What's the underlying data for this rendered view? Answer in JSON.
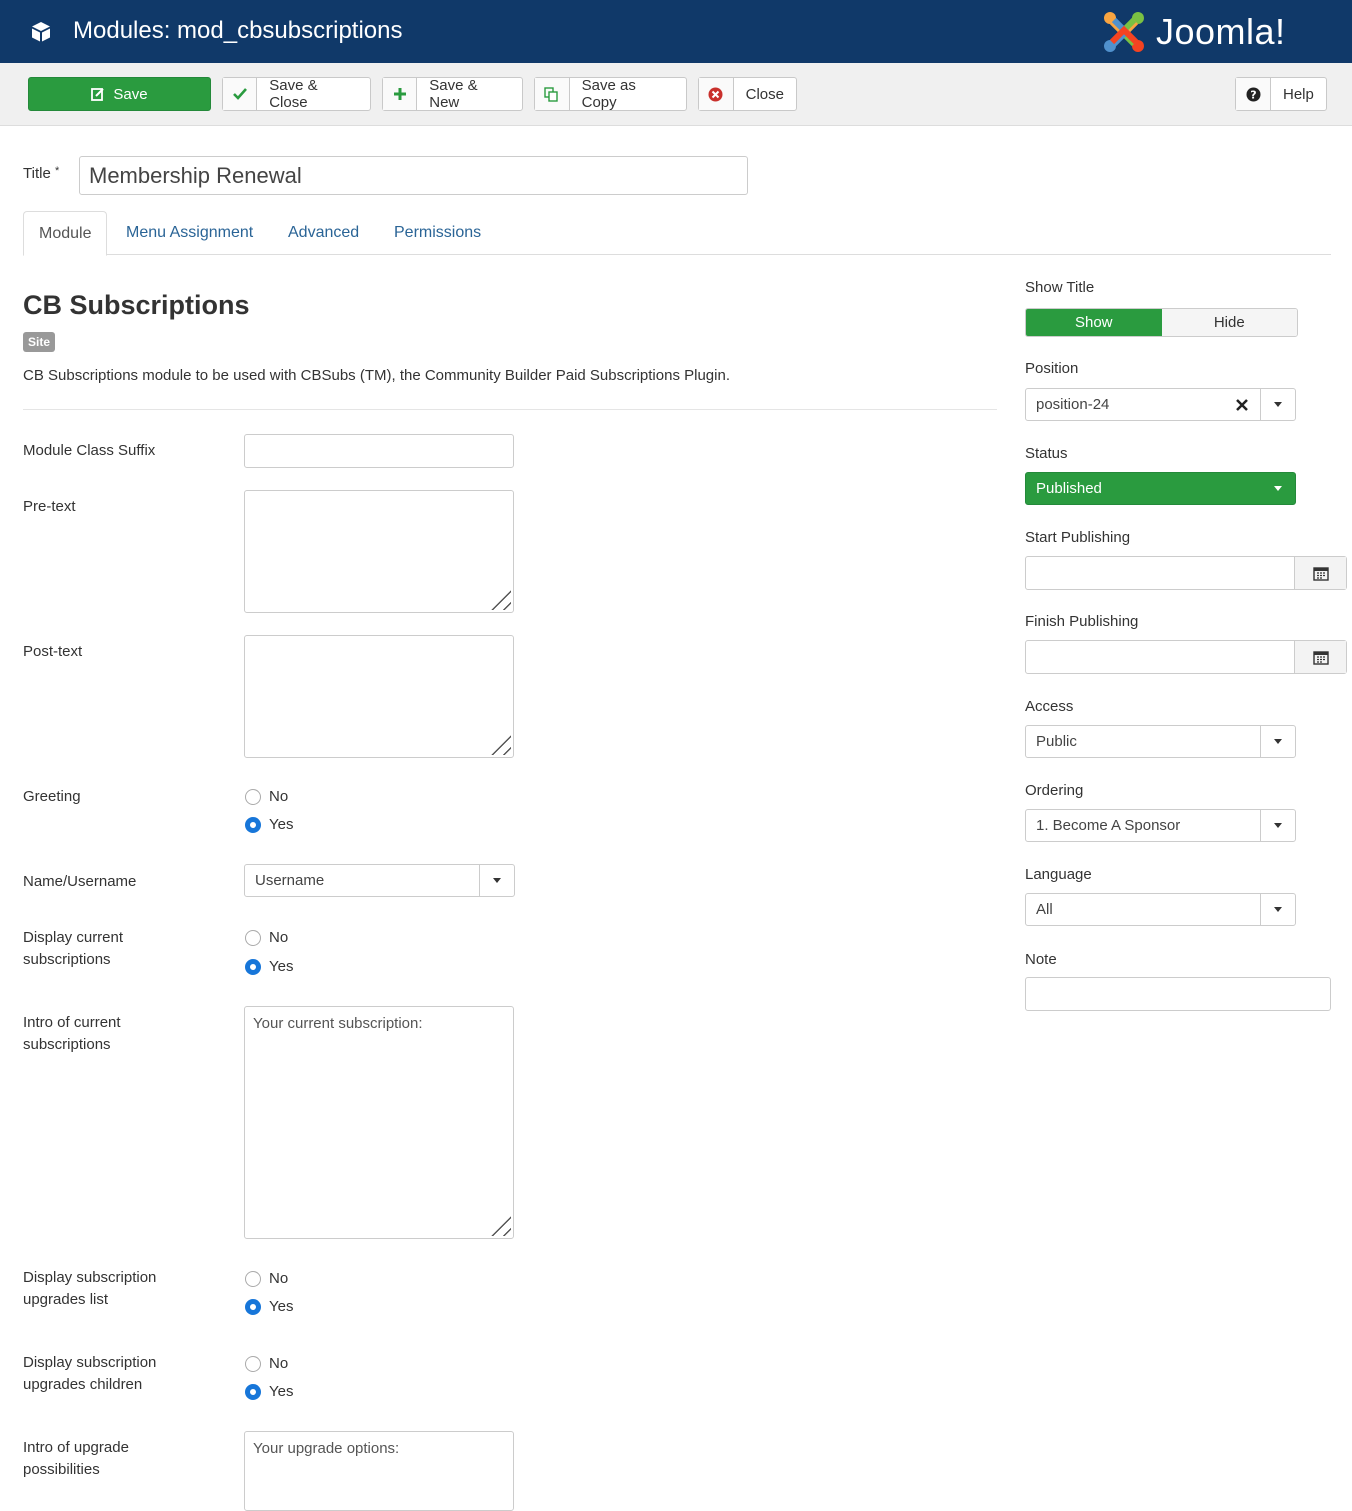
{
  "header": {
    "title": "Modules: mod_cbsubscriptions",
    "logo_text": "Joomla!"
  },
  "toolbar": {
    "save": "Save",
    "save_close": "Save & Close",
    "save_new": "Save & New",
    "save_copy": "Save as Copy",
    "close": "Close",
    "help": "Help"
  },
  "title_field": {
    "label": "Title",
    "required_mark": "*",
    "value": "Membership Renewal"
  },
  "tabs": [
    "Module",
    "Menu Assignment",
    "Advanced",
    "Permissions"
  ],
  "module": {
    "heading": "CB Subscriptions",
    "badge": "Site",
    "description": "CB Subscriptions module to be used with CBSubs (TM), the Community Builder Paid Subscriptions Plugin."
  },
  "fields": {
    "class_suffix": {
      "label": "Module Class Suffix",
      "value": ""
    },
    "pre_text": {
      "label": "Pre-text",
      "value": ""
    },
    "post_text": {
      "label": "Post-text",
      "value": ""
    },
    "greeting": {
      "label": "Greeting",
      "options": [
        "No",
        "Yes"
      ],
      "selected": "Yes"
    },
    "name_username": {
      "label": "Name/Username",
      "value": "Username"
    },
    "display_current": {
      "label": "Display current subscriptions",
      "options": [
        "No",
        "Yes"
      ],
      "selected": "Yes"
    },
    "intro_current": {
      "label": "Intro of current subscriptions",
      "value": "Your current subscription:"
    },
    "display_upgrades": {
      "label": "Display subscription upgrades list",
      "options": [
        "No",
        "Yes"
      ],
      "selected": "Yes"
    },
    "display_children": {
      "label": "Display subscription upgrades children",
      "options": [
        "No",
        "Yes"
      ],
      "selected": "Yes"
    },
    "intro_upgrade": {
      "label": "Intro of upgrade possibilities",
      "value": "Your upgrade options:"
    }
  },
  "sidebar": {
    "show_title": {
      "label": "Show Title",
      "options": [
        "Show",
        "Hide"
      ],
      "selected": "Show"
    },
    "position": {
      "label": "Position",
      "value": "position-24"
    },
    "status": {
      "label": "Status",
      "value": "Published"
    },
    "start_publishing": {
      "label": "Start Publishing",
      "value": ""
    },
    "finish_publishing": {
      "label": "Finish Publishing",
      "value": ""
    },
    "access": {
      "label": "Access",
      "value": "Public"
    },
    "ordering": {
      "label": "Ordering",
      "value": "1. Become A Sponsor"
    },
    "language": {
      "label": "Language",
      "value": "All"
    },
    "note": {
      "label": "Note",
      "value": ""
    }
  },
  "colors": {
    "header_bg": "#103969",
    "success": "#2a9b3f",
    "link": "#2a6496",
    "radio_on": "#1776d9"
  }
}
